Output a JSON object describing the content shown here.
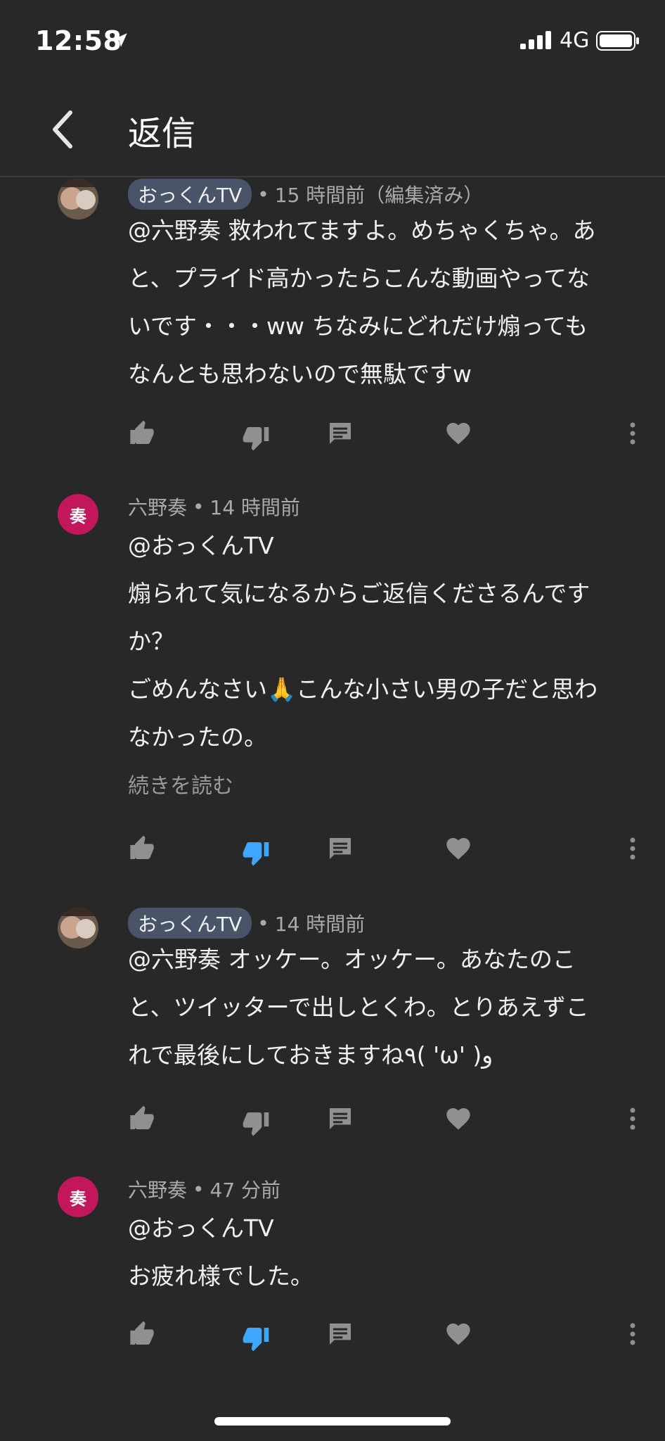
{
  "status_bar": {
    "time": "12:58",
    "network": "4G"
  },
  "header": {
    "title": "返信"
  },
  "colors": {
    "background": "#282828",
    "chip": "#4a5468",
    "dislike_active": "#3ea6ff",
    "avatar_initial_bg": "#c2185b"
  },
  "comments": [
    {
      "author": "おっくんTV",
      "author_is_creator": true,
      "time": "15 時間前（編集済み）",
      "lines": [
        "@六野奏 救われてますよ。めちゃくちゃ。あ",
        "と、プライド高かったらこんな動画やってな",
        "いです・・・ww ちなみにどれだけ煽っても",
        "なんとも思わないので無駄ですw"
      ],
      "disliked": false
    },
    {
      "author": "六野奏",
      "avatar_initial": "奏",
      "author_is_creator": false,
      "time": "14 時間前",
      "lines": [
        "@おっくんTV",
        "煽られて気になるからご返信くださるんです",
        "か？",
        "ごめんなさい🙏こんな小さい男の子だと思わ",
        "なかったの。"
      ],
      "read_more": "続きを読む",
      "disliked": true
    },
    {
      "author": "おっくんTV",
      "author_is_creator": true,
      "time": "14 時間前",
      "lines": [
        "@六野奏 オッケー。オッケー。あなたのこ",
        "と、ツイッターで出しとくわ。とりあえずこ",
        "れで最後にしておきますね٩( 'ω' )و"
      ],
      "disliked": false
    },
    {
      "author": "六野奏",
      "avatar_initial": "奏",
      "author_is_creator": false,
      "time": "47 分前",
      "lines": [
        "@おっくんTV",
        "お疲れ様でした。"
      ],
      "disliked": true
    }
  ],
  "meta_separator": "•",
  "icons": [
    "location-arrow-icon",
    "signal-icon",
    "battery-icon",
    "back-chevron-icon",
    "thumb-up-icon",
    "thumb-down-icon",
    "reply-icon",
    "heart-icon",
    "more-vert-icon"
  ]
}
